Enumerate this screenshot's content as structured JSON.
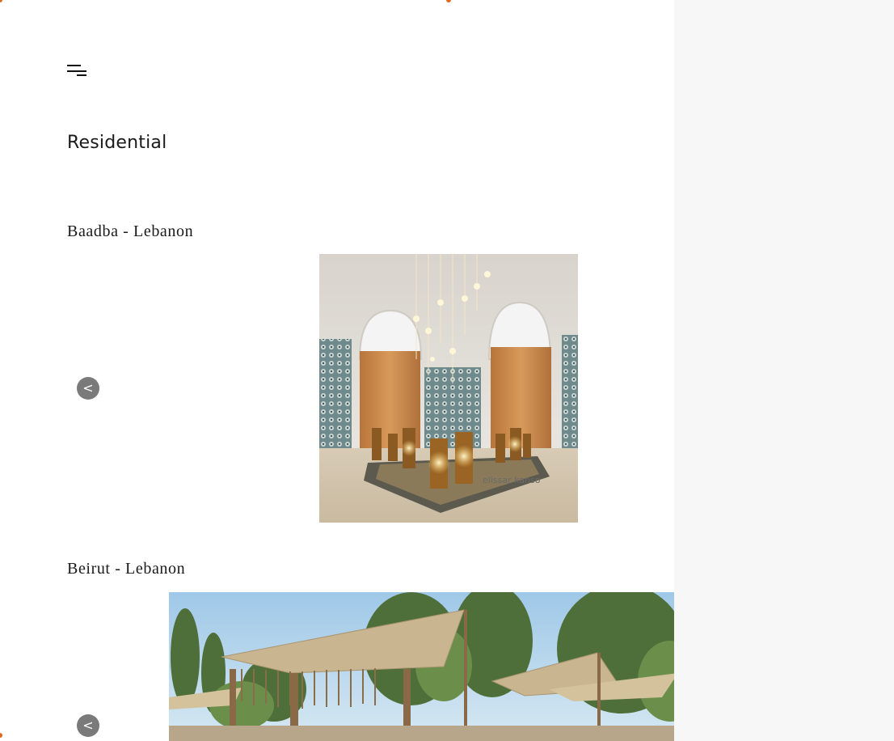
{
  "menu": {
    "icon": "hamburger-menu-icon"
  },
  "page": {
    "title": "Residential"
  },
  "projects": [
    {
      "location": "Baadba - Lebanon",
      "watermark": "elissar kanso",
      "prev_label": "<",
      "next_label": ">"
    },
    {
      "location": "Beirut - Lebanon",
      "prev_label": "<",
      "next_label": ">"
    }
  ],
  "colors": {
    "background": "#ffffff",
    "side_panel": "#f7f7f7",
    "nav_button": "#7a7a7a",
    "accent": "#e06a1a"
  }
}
